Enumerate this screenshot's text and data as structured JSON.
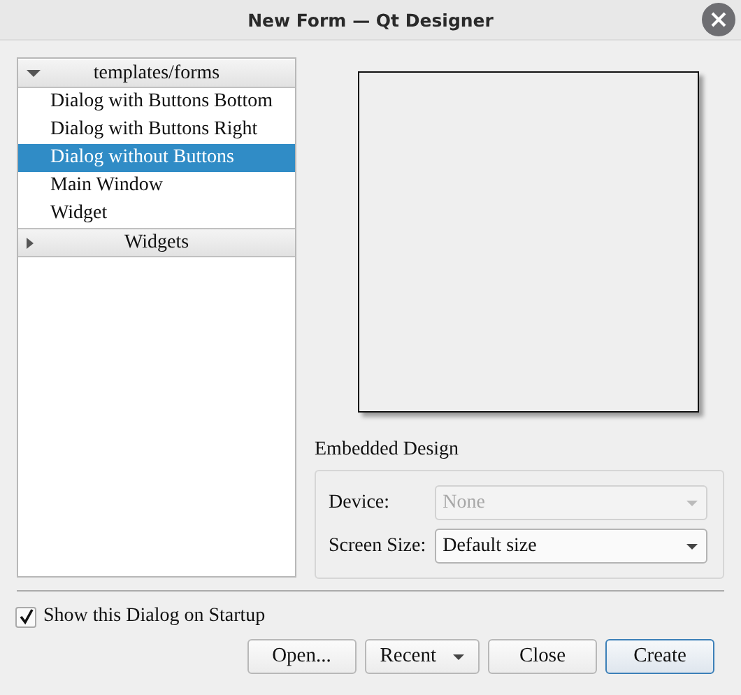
{
  "window": {
    "title": "New Form — Qt Designer"
  },
  "tree": [
    {
      "label": "templates/forms",
      "expanded": true,
      "children": [
        {
          "label": "Dialog with Buttons Bottom",
          "selected": false
        },
        {
          "label": "Dialog with Buttons Right",
          "selected": false
        },
        {
          "label": "Dialog without Buttons",
          "selected": true
        },
        {
          "label": "Main Window",
          "selected": false
        },
        {
          "label": "Widget",
          "selected": false
        }
      ]
    },
    {
      "label": "Widgets",
      "expanded": false
    }
  ],
  "embedded_design": {
    "title": "Embedded Design",
    "fields": [
      {
        "label": "Device:",
        "value": "None",
        "disabled": true
      },
      {
        "label": "Screen Size:",
        "value": "Default size",
        "disabled": false
      }
    ]
  },
  "show_on_startup": {
    "label": "Show this Dialog on Startup",
    "checked": true
  },
  "buttons": [
    {
      "label": "Open...",
      "kind": "plain",
      "default": false
    },
    {
      "label": "Recent",
      "kind": "menu",
      "default": false
    },
    {
      "label": "Close",
      "kind": "plain",
      "default": false
    },
    {
      "label": "Create",
      "kind": "plain",
      "default": true
    }
  ]
}
